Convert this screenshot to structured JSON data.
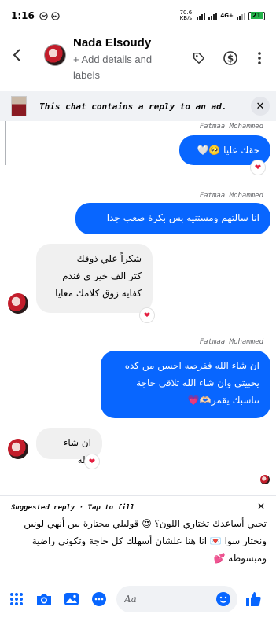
{
  "status": {
    "time": "1:16",
    "network_speed": "70.6 KB/s",
    "network_type": "4G+",
    "battery": "21"
  },
  "header": {
    "name": "Nada Elsoudy",
    "subtitle": "+ Add details and labels"
  },
  "banner": {
    "text": "This chat contains a reply to an ad."
  },
  "messages": [
    {
      "sender": "Fatmaa Mohammed",
      "text": "حقك عليا 🥺🤍",
      "reaction": "❤"
    },
    {
      "sender": "Fatmaa Mohammed",
      "text": "انا سالتهم ومستنيه بس بكرة صعب جدا"
    },
    {
      "text_lines": [
        "شكراً علي ذوقك",
        "كتر الف خير ي فندم",
        "كفايه زوق كلامك  معايا"
      ],
      "reaction": "❤"
    },
    {
      "sender": "Fatmaa Mohammed",
      "text_lines": [
        "ان شاء الله ففرصه احسن من كده",
        "يحبيتي وان شاء الله تلاقي حاجة",
        "تناسبك يقمر🫶🏻💗"
      ]
    },
    {
      "text": "ان شاء الله",
      "reaction": "❤"
    }
  ],
  "suggested_reply": {
    "title": "Suggested reply · Tap to fill",
    "text": "تحبي أساعدك تختاري اللون؟ 😍 قوليلي محتارة بين أنهي لونين ونختار سوا 💌 انا هنا علشان أسهلك كل حاجة وتكوني راضية ومبسوطة 💕"
  },
  "composer": {
    "placeholder": "Aa"
  },
  "colors": {
    "accent": "#0866ff",
    "incoming_bubble": "#f0f0f0",
    "reaction": "#e41e3f"
  }
}
